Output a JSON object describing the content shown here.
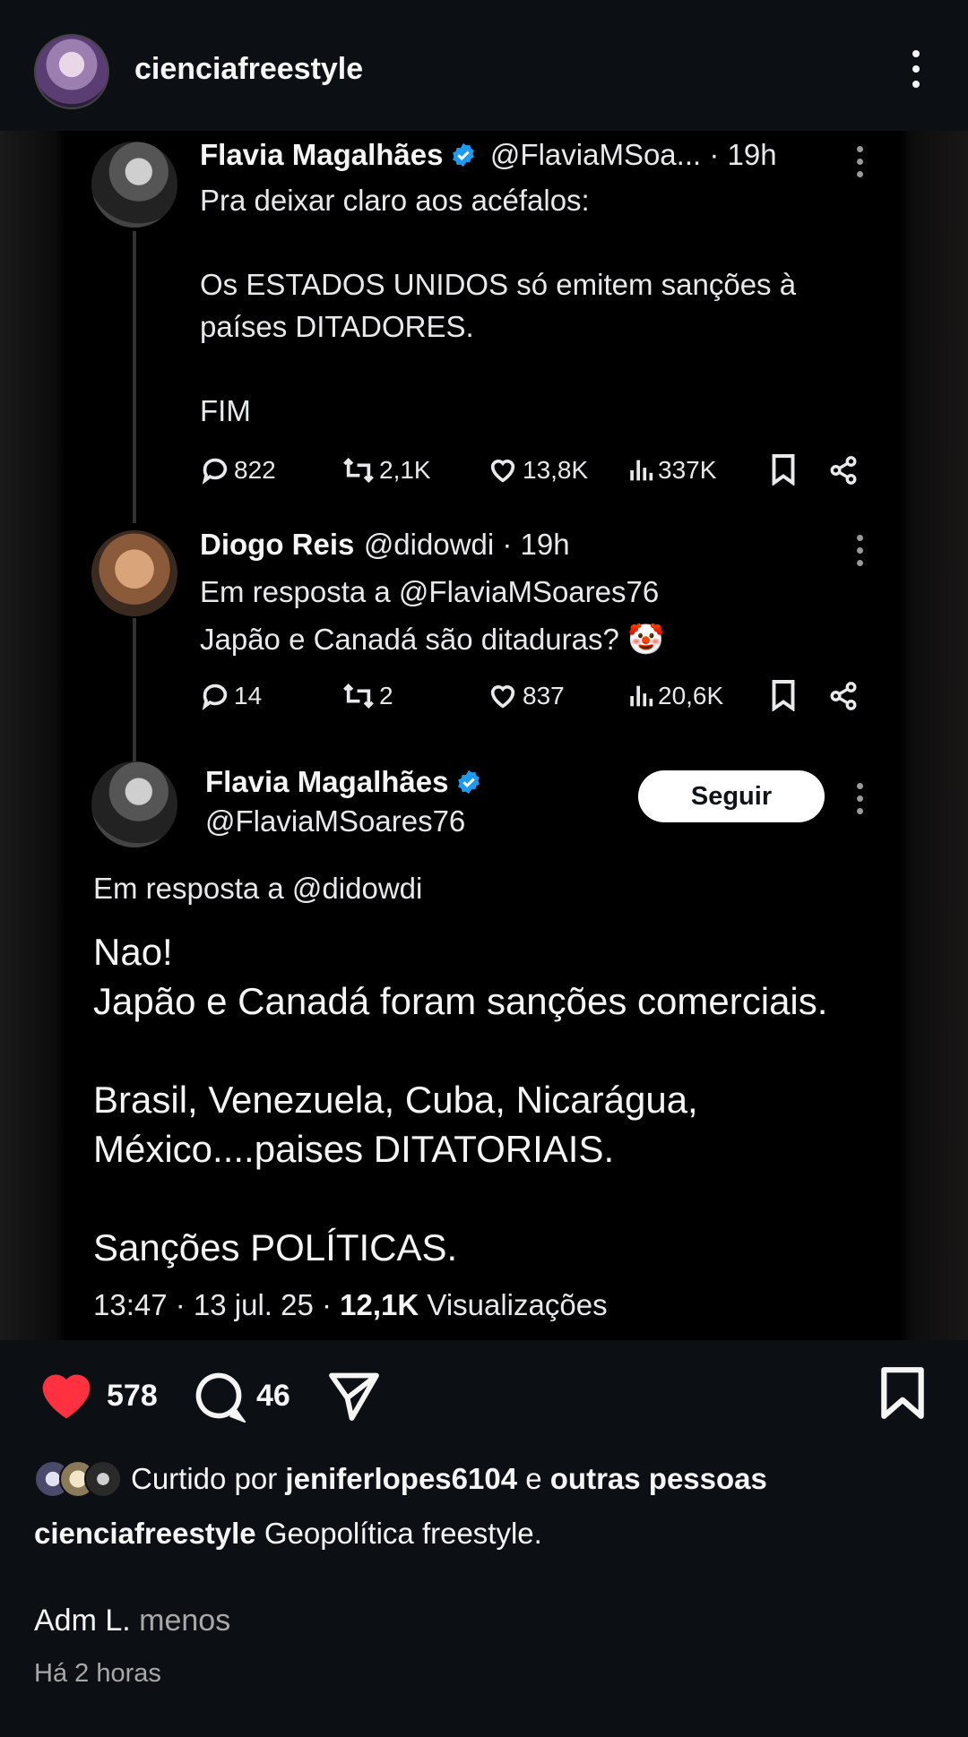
{
  "header": {
    "username": "cienciafreestyle"
  },
  "tweets": [
    {
      "name": "Flavia Magalhães",
      "handle_time": "@FlaviaMSoa... · 19h",
      "text": "Pra deixar claro aos acéfalos:\n\nOs ESTADOS UNIDOS só emitem sanções à\npaíses DITADORES.\n\nFIM",
      "replies": "822",
      "retweets": "2,1K",
      "likes": "13,8K",
      "views": "337K"
    },
    {
      "name": "Diogo Reis",
      "handle_time": "@didowdi · 19h",
      "reply_to": "Em resposta a @FlaviaMSoares76",
      "text": "Japão e Canadá são ditaduras? 🤡",
      "replies": "14",
      "retweets": "2",
      "likes": "837",
      "views": "20,6K"
    }
  ],
  "main_tweet": {
    "name": "Flavia Magalhães",
    "handle": "@FlaviaMSoares76",
    "follow_label": "Seguir",
    "reply_to": "Em resposta a @didowdi",
    "text": "Nao!\nJapão e Canadá foram sanções comerciais.\n\nBrasil, Venezuela, Cuba, Nicarágua,\nMéxico....paises DITATORIAIS.\n\nSanções POLÍTICAS.",
    "time_date": "13:47 · 13 jul. 25 · ",
    "views": "12,1K",
    "views_label": " Visualizações"
  },
  "post": {
    "likes": "578",
    "comments": "46",
    "liked_prefix": "Curtido por ",
    "liked_user": "jeniferlopes6104",
    "liked_mid": " e ",
    "liked_others": "outras pessoas",
    "caption_user": "cienciafreestyle",
    "caption_text": " Geopolítica freestyle.",
    "comment_user": "Adm L.",
    "comment_more": " menos",
    "time_ago": "Há 2 horas"
  },
  "colors": {
    "background": "#0c1014",
    "like_red": "#ff3040",
    "verified_blue": "#1d9bf0"
  },
  "icons": [
    "kebab-icon",
    "verified-icon",
    "reply-icon",
    "retweet-icon",
    "like-icon",
    "views-icon",
    "bookmark-icon",
    "share-icon",
    "heart-icon",
    "comment-icon",
    "send-icon",
    "save-icon"
  ]
}
